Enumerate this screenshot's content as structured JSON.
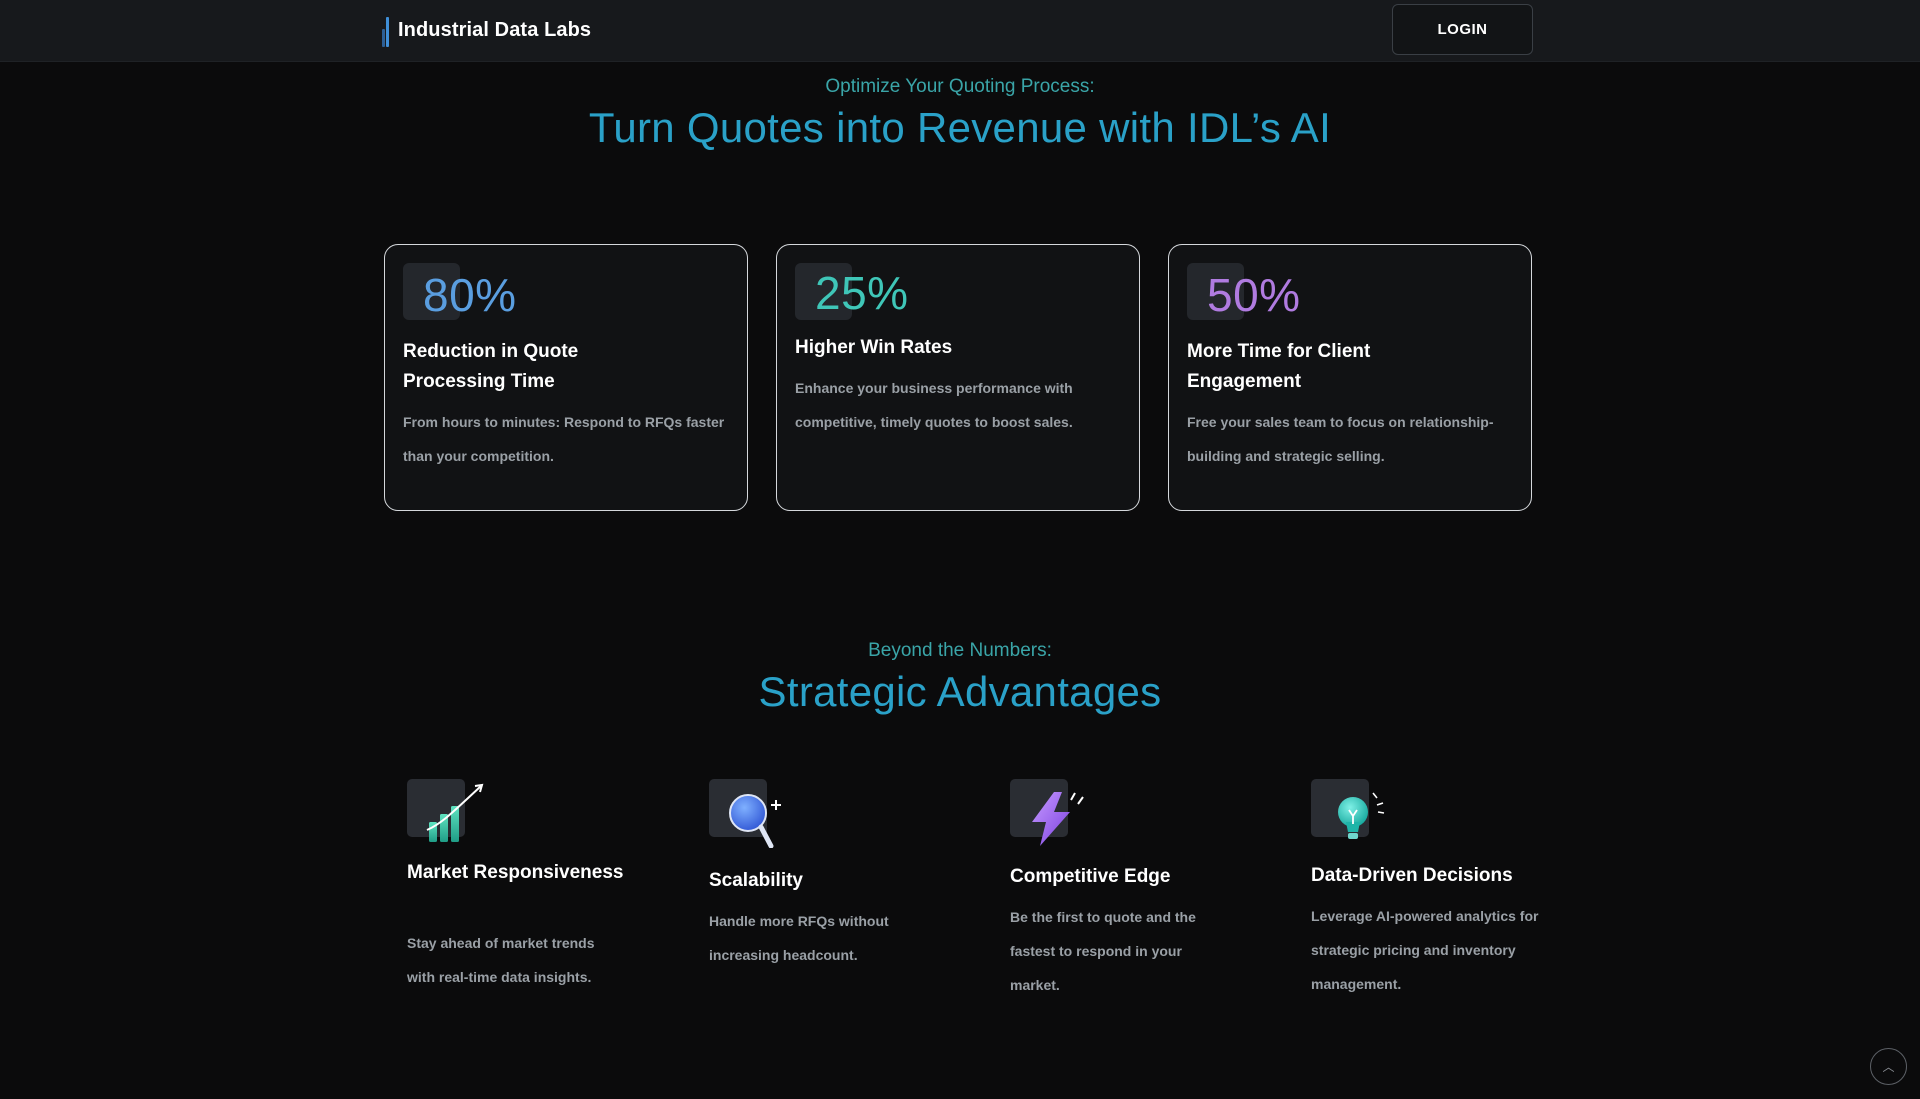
{
  "header": {
    "brand_name": "Industrial Data Labs",
    "login_label": "LOGIN"
  },
  "hero": {
    "eyebrow": "Optimize Your Quoting Process:",
    "headline": "Turn Quotes into Revenue with IDL’s AI"
  },
  "stats": [
    {
      "value": "80%",
      "title": "Reduction in Quote Processing Time",
      "description": "From hours to minutes: Respond to RFQs faster than your competition.",
      "color": "#5a9ee0"
    },
    {
      "value": "25%",
      "title": "Higher Win Rates",
      "description": "Enhance your business performance with competitive, timely quotes to boost sales.",
      "color": "#3fc6b8"
    },
    {
      "value": "50%",
      "title": "More Time for Client Engagement",
      "description": "Free your sales team to focus on relationship-building and strategic selling.",
      "color": "#b07be0"
    }
  ],
  "advantages_section": {
    "eyebrow": "Beyond the Numbers:",
    "headline": "Strategic Advantages"
  },
  "advantages": [
    {
      "icon": "bar-chart-growth-icon",
      "title": "Market Responsiveness",
      "description": "Stay ahead of market trends with real-time data insights."
    },
    {
      "icon": "magnifier-icon",
      "title": "Scalability",
      "description": "Handle more RFQs without increasing headcount."
    },
    {
      "icon": "lightning-bolt-icon",
      "title": "Competitive Edge",
      "description": "Be the first to quote and the fastest to respond in your market."
    },
    {
      "icon": "lightbulb-icon",
      "title": "Data-Driven Decisions",
      "description": "Leverage AI-powered analytics for strategic pricing and inventory management."
    }
  ],
  "scroll_top_icon": "chevron-up-icon"
}
